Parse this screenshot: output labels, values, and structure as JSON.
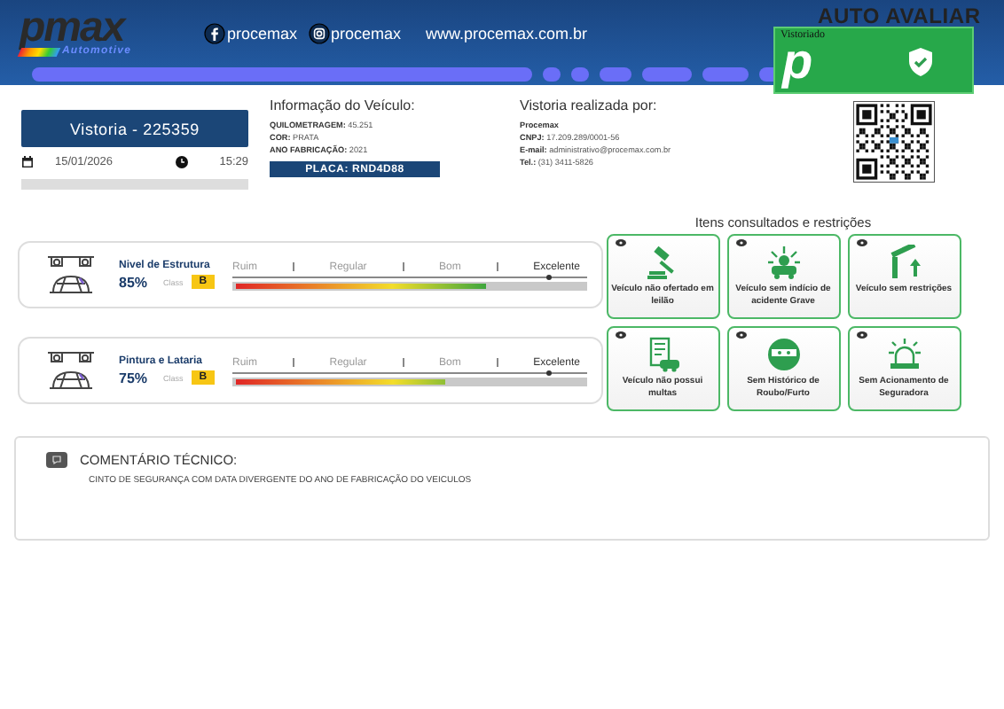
{
  "header": {
    "logo": {
      "name": "pmax",
      "tagline": "Automotive"
    },
    "social": [
      {
        "kind": "facebook",
        "handle": "procemax"
      },
      {
        "kind": "instagram",
        "handle": "procemax"
      }
    ],
    "website": "www.procemax.com.br",
    "partner_logo": "AUTO AVALIAR",
    "badge": {
      "label": "Vistoriado",
      "letter": "p"
    }
  },
  "inspection": {
    "title": "Vistoria - 225359",
    "date": "15/01/2026",
    "time": "15:29"
  },
  "vehicle": {
    "title": "Informação do Veículo:",
    "lines": [
      "**QUILOMETRAGEM:** 45.251",
      "**COR:** PRATA",
      "**ANO FABRICAÇÃO:** 2021"
    ],
    "plate": "PLACA: RND4D88"
  },
  "inspector": {
    "title": "Vistoria realizada por:",
    "lines": [
      "**Procemax**",
      "**CNPJ:** 17.209.289/0001-56",
      "**E-mail:** administrativo@procemax.com.br",
      "**Tel.:** (31) 3411-5826"
    ]
  },
  "scores": [
    {
      "name": "Nivel de Estrutura",
      "percent": "85%",
      "class_label": "Class",
      "class": "B",
      "scale": [
        "Ruim",
        "Regular",
        "Bom",
        "Excelente"
      ],
      "level": 0.72
    },
    {
      "name": "Pintura e Lataria",
      "percent": "75%",
      "class_label": "Class",
      "class": "B",
      "scale": [
        "Ruim",
        "Regular",
        "Bom",
        "Excelente"
      ],
      "level": 0.6
    }
  ],
  "checks": {
    "title": "Itens consultados e restrições",
    "items": [
      {
        "kind": "auction",
        "label": "Veículo não ofertado em leilão"
      },
      {
        "kind": "accident",
        "label": "Veículo sem indício de acidente Grave"
      },
      {
        "kind": "barrier",
        "label": "Veículo sem restrições"
      },
      {
        "kind": "fines",
        "label": "Veículo não possui multas"
      },
      {
        "kind": "theft",
        "label": "Sem Histórico de Roubo/Furto"
      },
      {
        "kind": "alarm",
        "label": "Sem Acionamento de Seguradora"
      }
    ]
  },
  "comment": {
    "title": "COMENTÁRIO TÉCNICO:",
    "text": "CINTO DE SEGURANÇA COM DATA DIVERGENTE DO ANO DE FABRICAÇÃO DO VEICULOS"
  }
}
